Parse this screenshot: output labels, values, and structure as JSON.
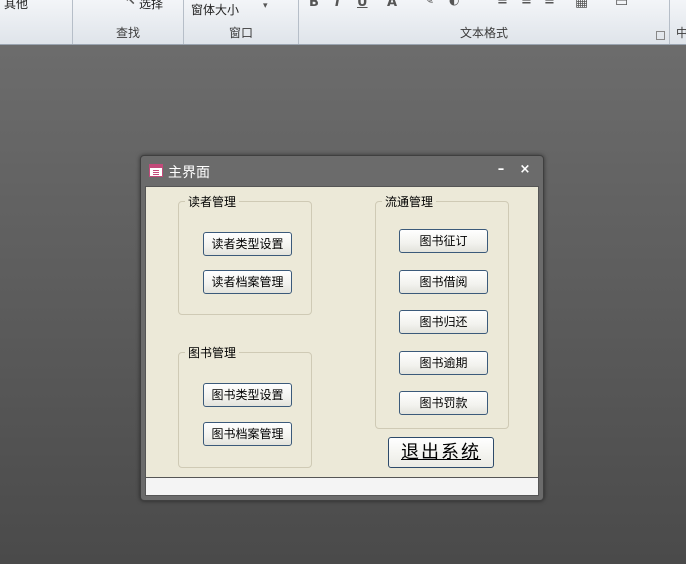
{
  "ribbon": {
    "other_label": "其他",
    "select_label": "选择",
    "window_size_label": "窗体大小",
    "groups": {
      "find": "查找",
      "window": "窗口",
      "text_format": "文本格式",
      "chinese": "中"
    },
    "format_glyphs": {
      "bold": "B",
      "italic": "I",
      "underline": "U",
      "font_color": "A"
    }
  },
  "form": {
    "title": "主界面",
    "minimize_glyph": "–",
    "close_glyph": "×",
    "reader_group": {
      "legend": "读者管理",
      "buttons": [
        "读者类型设置",
        "读者档案管理"
      ]
    },
    "book_group": {
      "legend": "图书管理",
      "buttons": [
        "图书类型设置",
        "图书档案管理"
      ]
    },
    "circulation_group": {
      "legend": "流通管理",
      "buttons": [
        "图书征订",
        "图书借阅",
        "图书归还",
        "图书逾期",
        "图书罚款"
      ]
    },
    "exit_button": "退出系统"
  }
}
